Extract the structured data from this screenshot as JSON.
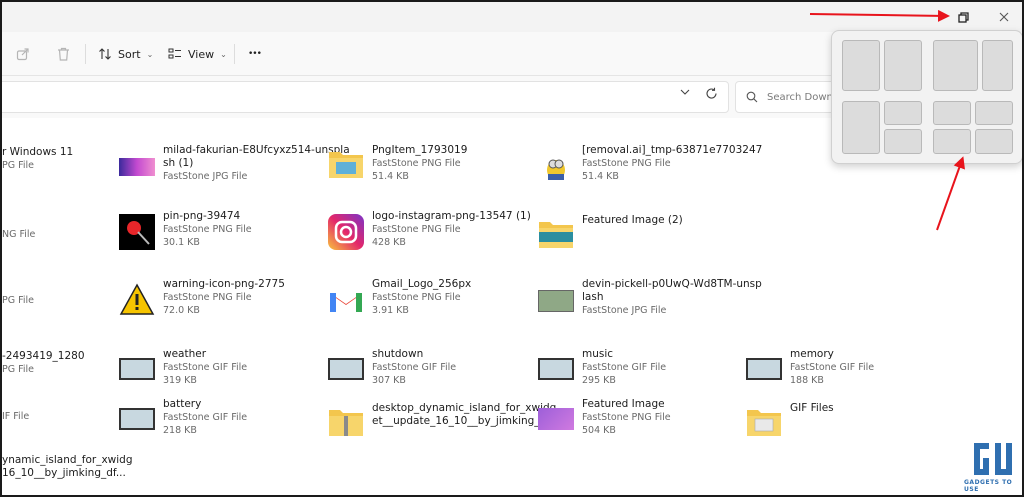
{
  "toolbar": {
    "sort_label": "Sort",
    "view_label": "View",
    "more_label": "•••"
  },
  "search": {
    "placeholder": "Search Downlo"
  },
  "files": [
    {
      "name": "r Windows 11",
      "type": "PG File",
      "size": ""
    },
    {
      "name": "milad-fakurian-E8Ufcyxz514-unspla",
      "name2": "sh (1)",
      "type": "FastStone JPG File",
      "size": ""
    },
    {
      "name": "PngItem_1793019",
      "type": "FastStone PNG File",
      "size": "51.4 KB"
    },
    {
      "name": "[removal.ai]_tmp-63871e7703247",
      "type": "FastStone PNG File",
      "size": "51.4 KB"
    },
    {
      "name": "",
      "type": "NG File",
      "size": ""
    },
    {
      "name": "pin-png-39474",
      "type": "FastStone PNG File",
      "size": "30.1 KB"
    },
    {
      "name": "logo-instagram-png-13547 (1)",
      "type": "FastStone PNG File",
      "size": "428 KB"
    },
    {
      "name": "Featured Image (2)",
      "type": "",
      "size": ""
    },
    {
      "name": "",
      "type": "PG File",
      "size": ""
    },
    {
      "name": "warning-icon-png-2775",
      "type": "FastStone PNG File",
      "size": "72.0 KB"
    },
    {
      "name": "Gmail_Logo_256px",
      "type": "FastStone PNG File",
      "size": "3.91 KB"
    },
    {
      "name": "devin-pickell-p0UwQ-Wd8TM-unsp",
      "name2": "lash",
      "type": "FastStone JPG File",
      "size": ""
    },
    {
      "name": "-2493419_1280",
      "type": "PG File",
      "size": ""
    },
    {
      "name": "weather",
      "type": "FastStone GIF File",
      "size": "319 KB"
    },
    {
      "name": "shutdown",
      "type": "FastStone GIF File",
      "size": "307 KB"
    },
    {
      "name": "music",
      "type": "FastStone GIF File",
      "size": "295 KB"
    },
    {
      "name": "memory",
      "type": "FastStone GIF File",
      "size": "188 KB"
    },
    {
      "name": "",
      "type": "IF File",
      "size": ""
    },
    {
      "name": "battery",
      "type": "FastStone GIF File",
      "size": "218 KB"
    },
    {
      "name": "desktop_dynamic_island_for_xwidg",
      "name2": "et__update_16_10__by_jimking_df...",
      "type": "",
      "size": ""
    },
    {
      "name": "Featured Image",
      "type": "FastStone PNG File",
      "size": "504 KB"
    },
    {
      "name": "GIF Files",
      "type": "",
      "size": ""
    },
    {
      "name": "ynamic_island_for_xwidg",
      "name2": "16_10__by_jimking_df...",
      "type": "",
      "size": ""
    }
  ],
  "watermark": {
    "text": "GADGETS TO USE"
  },
  "colors": {
    "arrow": "#e8141c",
    "folder": "#f3c64d"
  }
}
